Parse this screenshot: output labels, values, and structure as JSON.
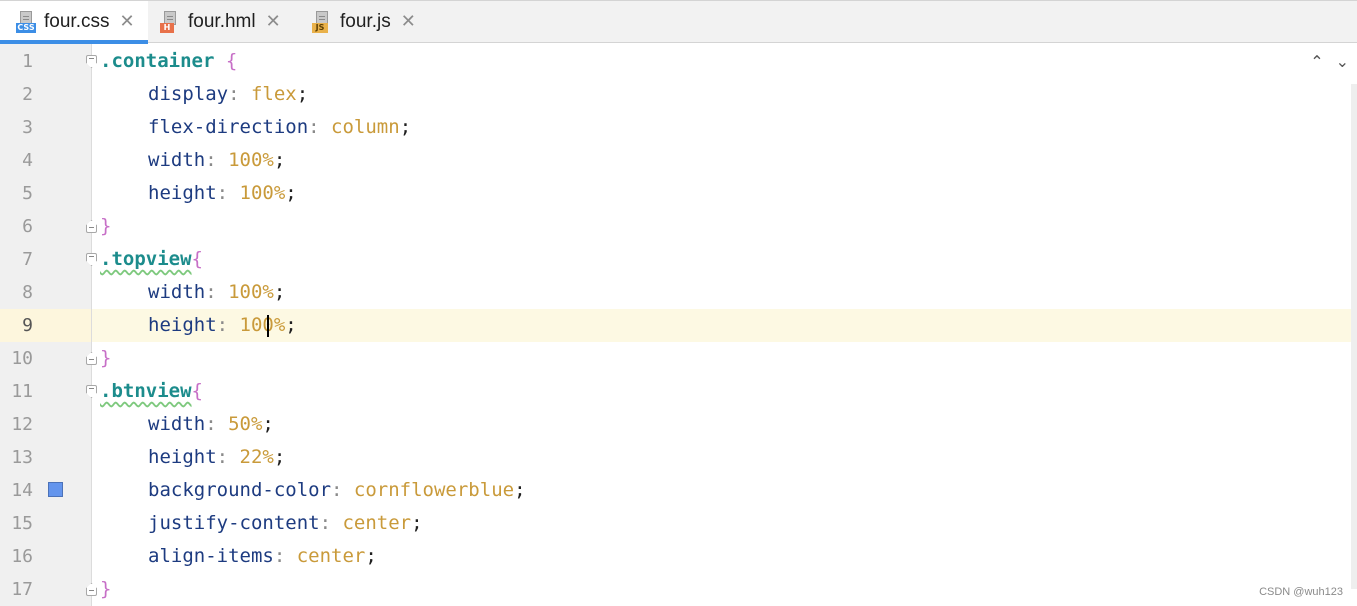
{
  "tabs": [
    {
      "label": "four.css",
      "badge": "CSS",
      "icon": "css-file-icon",
      "active": true
    },
    {
      "label": "four.hml",
      "badge": "H",
      "icon": "html-file-icon",
      "active": false
    },
    {
      "label": "four.js",
      "badge": "JS",
      "icon": "js-file-icon",
      "active": false
    }
  ],
  "close_glyph": "✕",
  "nav": {
    "prev": "⌃",
    "next": "⌄"
  },
  "lines": [
    {
      "num": "1",
      "selector": ".container",
      "brace": " {"
    },
    {
      "num": "2",
      "prop": "display",
      "value": "flex"
    },
    {
      "num": "3",
      "prop": "flex-direction",
      "value": "column"
    },
    {
      "num": "4",
      "prop": "width",
      "value": "100%"
    },
    {
      "num": "5",
      "prop": "height",
      "value": "100%"
    },
    {
      "num": "6",
      "brace": "}"
    },
    {
      "num": "7",
      "selector": ".topview",
      "brace": "{"
    },
    {
      "num": "8",
      "prop": "width",
      "value": "100%"
    },
    {
      "num": "9",
      "prop": "height",
      "value": "100%"
    },
    {
      "num": "10",
      "brace": "}"
    },
    {
      "num": "11",
      "selector": ".btnview",
      "brace": "{"
    },
    {
      "num": "12",
      "prop": "width",
      "value": "50%"
    },
    {
      "num": "13",
      "prop": "height",
      "value": "22%"
    },
    {
      "num": "14",
      "prop": "background-color",
      "value": "cornflowerblue"
    },
    {
      "num": "15",
      "prop": "justify-content",
      "value": "center"
    },
    {
      "num": "16",
      "prop": "align-items",
      "value": "center"
    },
    {
      "num": "17",
      "brace": "}"
    }
  ],
  "colors": {
    "swatch": "#6495ed",
    "current_line": "#fdf9e3",
    "active_tab_underline": "#3c8ee6"
  },
  "watermark": "CSDN @wuh123"
}
